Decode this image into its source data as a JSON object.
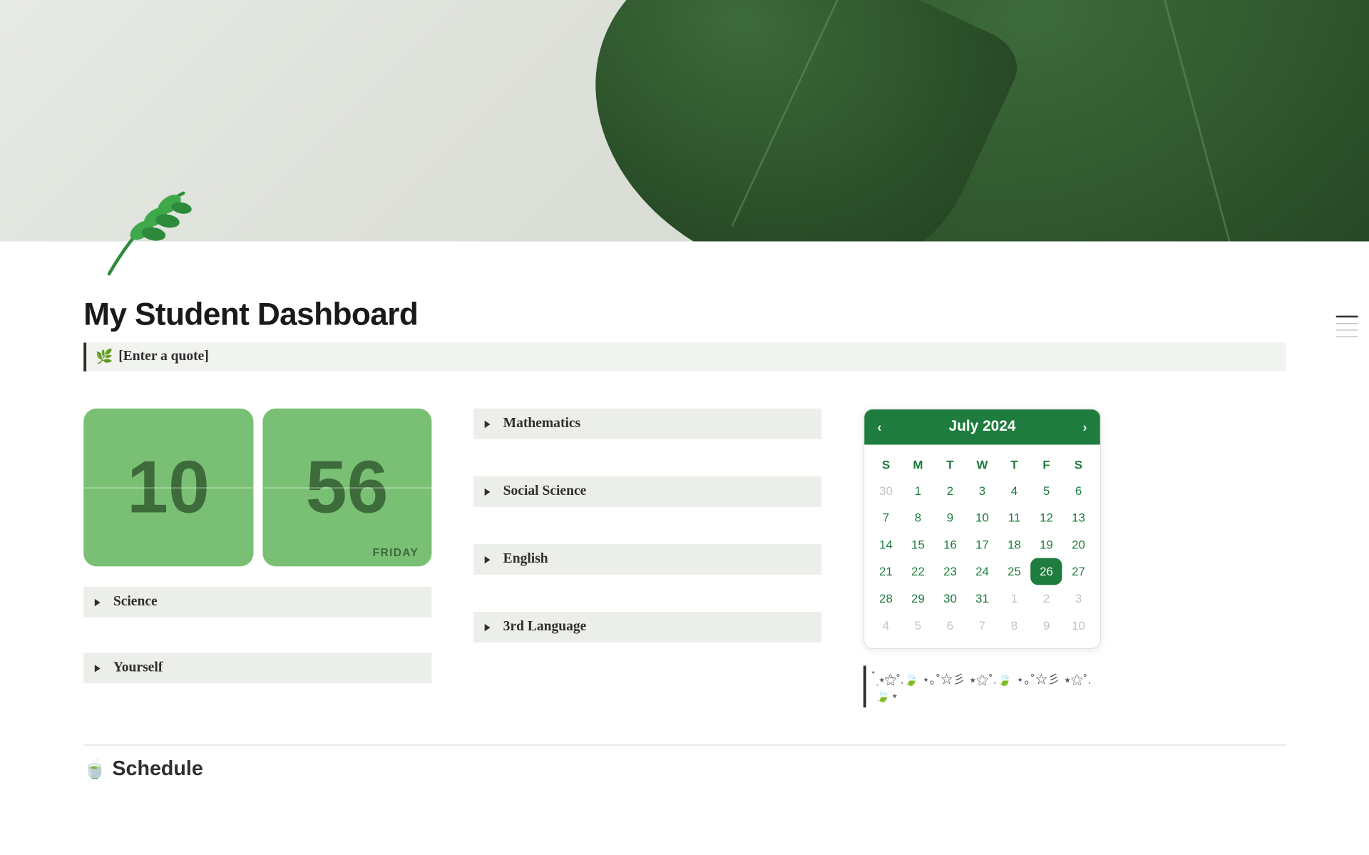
{
  "page": {
    "title": "My Student Dashboard",
    "quote_emoji": "🌿",
    "quote_text": "[Enter a quote]"
  },
  "clock": {
    "hour": "10",
    "minute": "56",
    "day": "FRIDAY"
  },
  "subjects_left": [
    {
      "label": "Science"
    },
    {
      "label": "Yourself"
    }
  ],
  "subjects_mid": [
    {
      "label": "Mathematics"
    },
    {
      "label": "Social Science"
    },
    {
      "label": "English"
    },
    {
      "label": "3rd Language"
    }
  ],
  "calendar": {
    "title": "July 2024",
    "dow": [
      "S",
      "M",
      "T",
      "W",
      "T",
      "F",
      "S"
    ],
    "weeks": [
      [
        {
          "d": "30",
          "out": true
        },
        {
          "d": "1"
        },
        {
          "d": "2"
        },
        {
          "d": "3"
        },
        {
          "d": "4"
        },
        {
          "d": "5"
        },
        {
          "d": "6"
        }
      ],
      [
        {
          "d": "7"
        },
        {
          "d": "8"
        },
        {
          "d": "9"
        },
        {
          "d": "10"
        },
        {
          "d": "11"
        },
        {
          "d": "12"
        },
        {
          "d": "13"
        }
      ],
      [
        {
          "d": "14"
        },
        {
          "d": "15"
        },
        {
          "d": "16"
        },
        {
          "d": "17"
        },
        {
          "d": "18"
        },
        {
          "d": "19"
        },
        {
          "d": "20"
        }
      ],
      [
        {
          "d": "21"
        },
        {
          "d": "22"
        },
        {
          "d": "23"
        },
        {
          "d": "24"
        },
        {
          "d": "25"
        },
        {
          "d": "26",
          "today": true
        },
        {
          "d": "27"
        }
      ],
      [
        {
          "d": "28"
        },
        {
          "d": "29"
        },
        {
          "d": "30"
        },
        {
          "d": "31"
        },
        {
          "d": "1",
          "out": true
        },
        {
          "d": "2",
          "out": true
        },
        {
          "d": "3",
          "out": true
        }
      ],
      [
        {
          "d": "4",
          "out": true
        },
        {
          "d": "5",
          "out": true
        },
        {
          "d": "6",
          "out": true
        },
        {
          "d": "7",
          "out": true
        },
        {
          "d": "8",
          "out": true
        },
        {
          "d": "9",
          "out": true
        },
        {
          "d": "10",
          "out": true
        }
      ]
    ]
  },
  "decoration": "๋࣭ ⭑⚝˚.🍃 ⋆｡˚☆彡 ⭑⚝˚.🍃 ⋆｡˚☆彡 ⭑⚝˚.🍃⋆",
  "schedule": {
    "emoji": "🍵",
    "title": "Schedule"
  }
}
